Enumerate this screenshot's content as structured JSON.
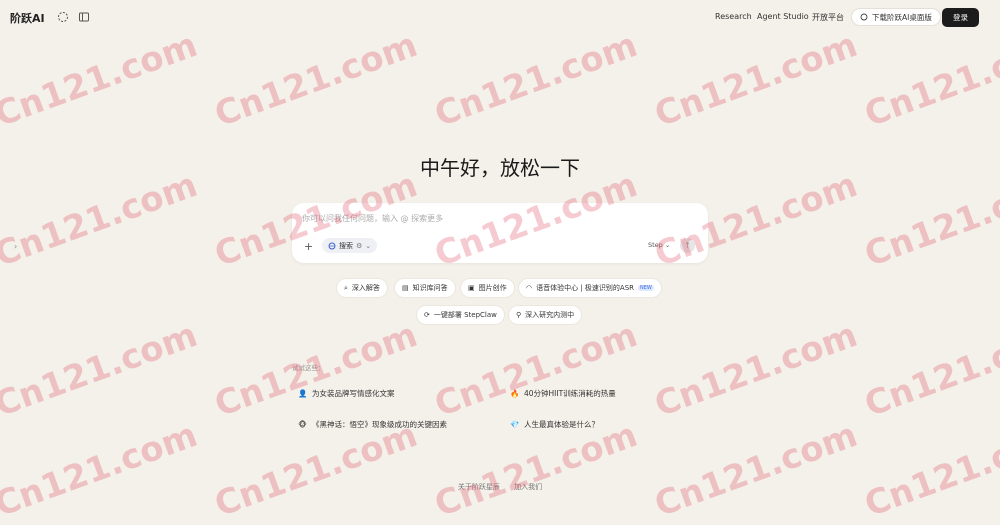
{
  "header": {
    "brand": "阶跃AI",
    "nav": [
      "Research",
      "Agent Studio",
      "开放平台"
    ],
    "download_label": "下载阶跃AI桌面版",
    "login_label": "登录"
  },
  "greeting": "中午好，放松一下",
  "composer": {
    "placeholder": "你可以问我任何问题，输入 @ 探索更多",
    "search_label": "搜索",
    "model_label": "Step"
  },
  "quick_actions": [
    {
      "icon": "search-icon",
      "label": "深入解答"
    },
    {
      "icon": "book-icon",
      "label": "知识库问答"
    },
    {
      "icon": "image-icon",
      "label": "图片创作"
    },
    {
      "icon": "headphones-icon",
      "label": "语音体验中心 | 极速识别的ASR",
      "badge": "NEW"
    },
    {
      "icon": "deploy-icon",
      "label": "一键部署 StepClaw"
    },
    {
      "icon": "research-icon",
      "label": "深入研究内测中"
    }
  ],
  "suggestions": {
    "label": "试试这些：",
    "items": [
      {
        "icon": "👤",
        "label": "为女装品牌写情感化文案"
      },
      {
        "icon": "🔥",
        "label": "40分钟HIIT训练消耗的热量"
      },
      {
        "icon": "🐵",
        "label": "《黑神话：悟空》现象级成功的关键因素"
      },
      {
        "icon": "💎",
        "label": "人生最真体验是什么？"
      }
    ]
  },
  "footer": [
    "关于阶跃星辰",
    "加入我们"
  ],
  "watermark": "Cn121.com"
}
